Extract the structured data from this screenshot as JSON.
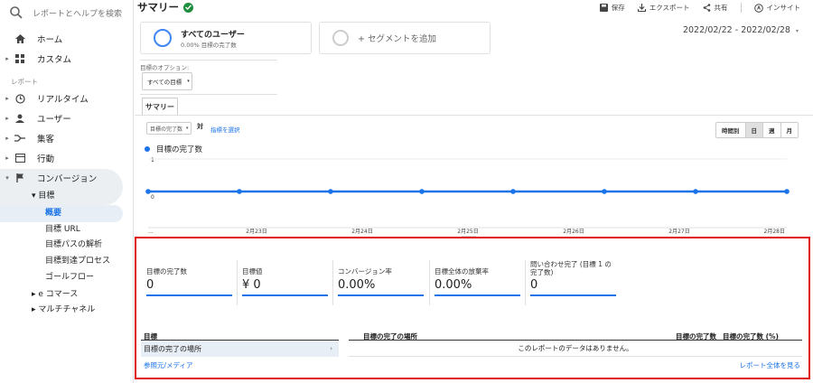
{
  "search": {
    "placeholder": "レポートとヘルプを検索"
  },
  "sidebar": {
    "home": "ホーム",
    "custom": "カスタム",
    "reports_label": "レポート",
    "realtime": "リアルタイム",
    "user": "ユーザー",
    "acquisition": "集客",
    "behavior": "行動",
    "conversion": "コンバージョン",
    "goals": "目標",
    "goals_items": [
      "概要",
      "目標 URL",
      "目標パスの解析",
      "目標到達プロセス",
      "ゴールフロー"
    ],
    "ecommerce": "e コマース",
    "multichannel": "マルチチャネル"
  },
  "header": {
    "title": "サマリー",
    "save": "保存",
    "export": "エクスポート",
    "share": "共有",
    "insight": "インサイト"
  },
  "segments": {
    "all_users": "すべてのユーザー",
    "all_users_sub": "0.00% 目標の完了数",
    "add_segment": "+ セグメントを追加"
  },
  "daterange": "2022/02/22 - 2022/02/28",
  "options": {
    "label": "目標のオプション:",
    "select_value": "すべての目標"
  },
  "tab": "サマリー",
  "chart_controls": {
    "metric": "目標の完了数",
    "vs": "対",
    "pick": "指標を選択",
    "periods": [
      "時間別",
      "日",
      "週",
      "月"
    ],
    "selected_period": "日"
  },
  "chart_data": {
    "type": "line",
    "series": [
      {
        "name": "目標の完了数",
        "values": [
          0,
          0,
          0,
          0,
          0,
          0,
          0,
          0
        ]
      }
    ],
    "x": [
      "...",
      "2月23日",
      "2月24日",
      "2月25日",
      "2月26日",
      "2月27日",
      "2月28日"
    ],
    "yticks": [
      "1",
      "0"
    ],
    "ylim": [
      0,
      1
    ],
    "color": "#1a73e8"
  },
  "kpis": [
    {
      "label": "目標の完了数",
      "value": "0"
    },
    {
      "label": "目標値",
      "value": "¥ 0"
    },
    {
      "label": "コンバージョン率",
      "value": "0.00%"
    },
    {
      "label": "目標全体の放棄率",
      "value": "0.00%"
    },
    {
      "label": "問い合わせ完了 (目標 1 の完了数)",
      "value": "0"
    }
  ],
  "goal_table": {
    "left_header": "目標",
    "left_row": "目標の完了の場所",
    "col1": "目標の完了の場所",
    "col2": "目標の完了数",
    "col3": "目標の完了数 (%)",
    "no_data": "このレポートのデータはありません。",
    "source_link": "参照元/メディア",
    "full_report": "レポート全体を見る"
  }
}
